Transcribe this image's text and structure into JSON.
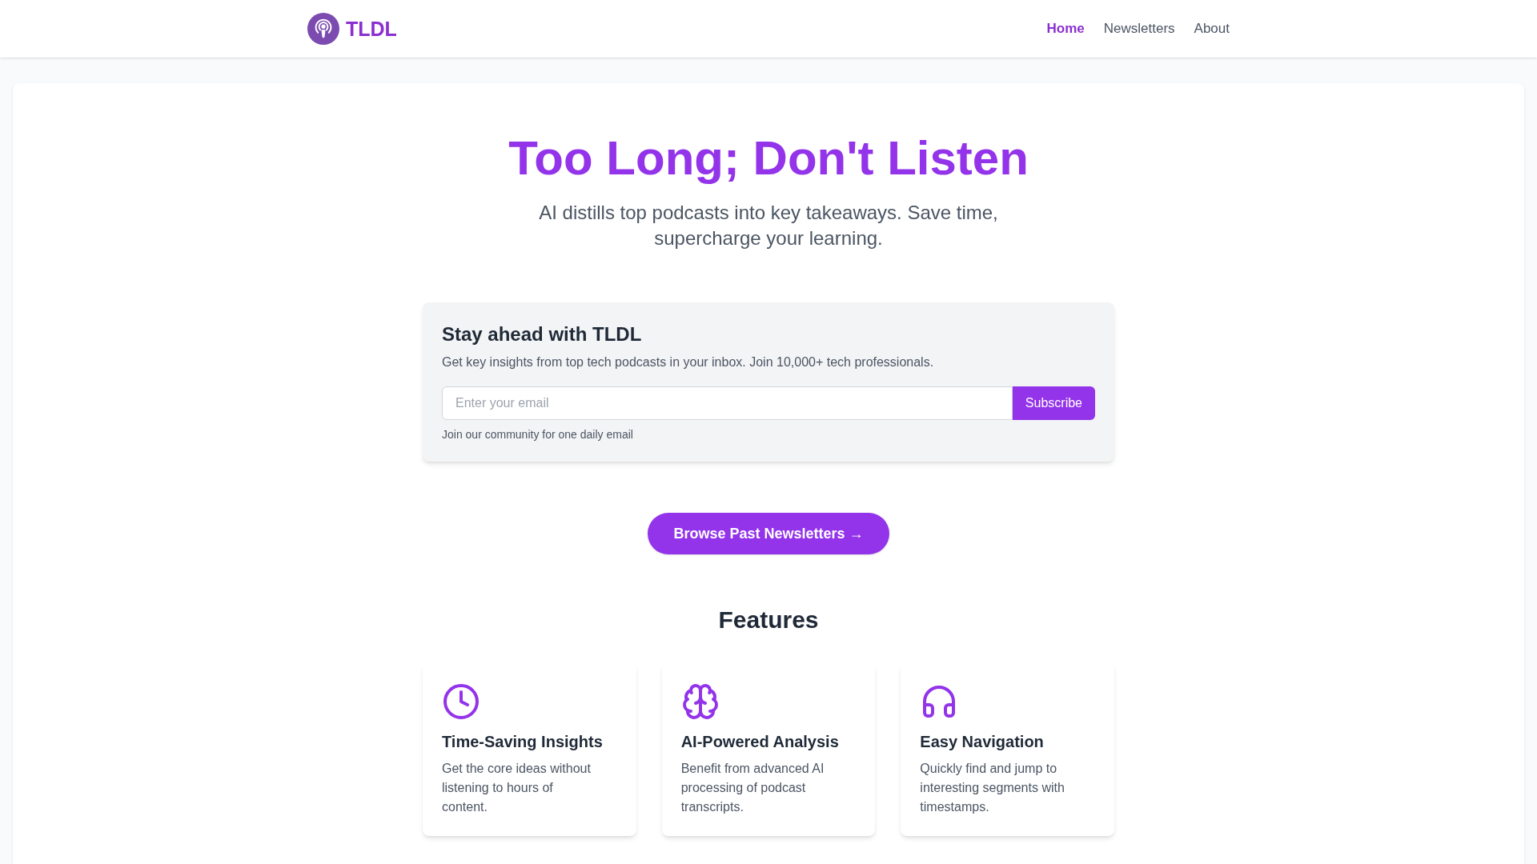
{
  "header": {
    "brand": "TLDL",
    "nav": [
      {
        "label": "Home",
        "selected": true
      },
      {
        "label": "Newsletters",
        "selected": false
      },
      {
        "label": "About",
        "selected": false
      }
    ]
  },
  "hero": {
    "title": "Too Long; Don't Listen",
    "subtitle": "AI distills top podcasts into key takeaways. Save time, supercharge your learning."
  },
  "subscribe": {
    "title": "Stay ahead with TLDL",
    "description": "Get key insights from top tech podcasts in your inbox. Join 10,000+ tech professionals.",
    "email": {
      "placeholder": "Enter your email"
    },
    "button": "Subscribe",
    "note": "Join our community for one daily email"
  },
  "browse_button": "Browse Past Newsletters →",
  "features": {
    "title": "Features",
    "items": [
      {
        "title": "Time-Saving Insights",
        "description": "Get the core ideas without listening to hours of content."
      },
      {
        "title": "AI-Powered Analysis",
        "description": "Benefit from advanced AI processing of podcast transcripts."
      },
      {
        "title": "Easy Navigation",
        "description": "Quickly find and jump to interesting segments with timestamps."
      }
    ]
  }
}
